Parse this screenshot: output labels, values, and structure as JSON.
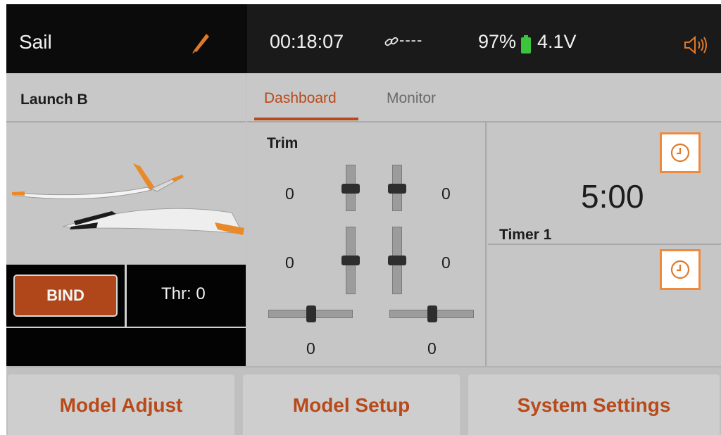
{
  "header": {
    "model_name": "Sail",
    "timer": "00:18:07",
    "signal": "----",
    "battery_percent": "97%",
    "voltage": "4.1V"
  },
  "subheader": {
    "flight_mode": "Launch B",
    "tabs": [
      {
        "label": "Dashboard",
        "active": true
      },
      {
        "label": "Monitor",
        "active": false
      }
    ]
  },
  "left_panel": {
    "bind_label": "BIND",
    "throttle_label": "Thr: 0"
  },
  "trim": {
    "title": "Trim",
    "left_upper": "0",
    "right_upper": "0",
    "left_lower": "0",
    "right_lower": "0",
    "left_bottom": "0",
    "right_bottom": "0"
  },
  "timers": {
    "timer1_value": "5:00",
    "timer1_label": "Timer 1"
  },
  "bottom_nav": {
    "model_adjust": "Model Adjust",
    "model_setup": "Model Setup",
    "system_settings": "System Settings"
  },
  "colors": {
    "accent": "#b84a1a",
    "highlight_box": "#ef8a3c",
    "battery_green": "#3cc43c",
    "speaker": "#e07a2a"
  },
  "icons": [
    "pencil-icon",
    "link-icon",
    "battery-icon",
    "speaker-icon",
    "clock-icon"
  ]
}
